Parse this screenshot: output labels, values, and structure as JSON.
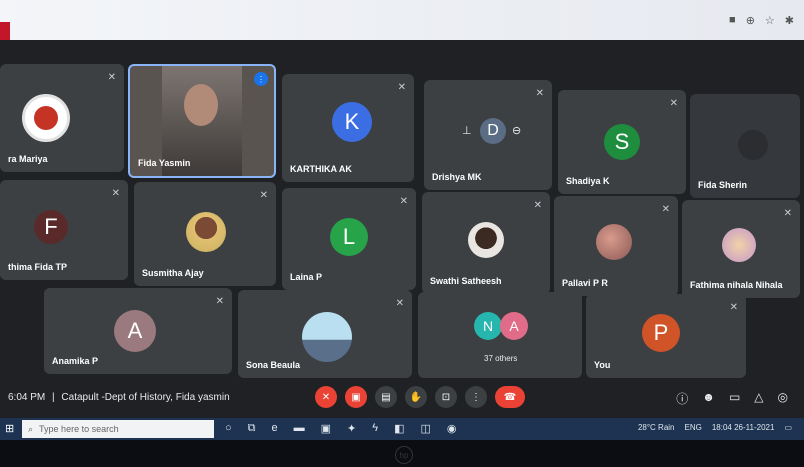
{
  "meeting": {
    "time": "6:04 PM",
    "separator": "|",
    "title": "Catapult -Dept of History, Fida yasmin"
  },
  "participants": {
    "ra_mariya": "ra Mariya",
    "fida_yasmin": "Fida Yasmin",
    "karthika": "KARTHIKA AK",
    "karthika_initial": "K",
    "drishya": "Drishya MK",
    "drishya_initial": "D",
    "shadiya": "Shadiya K",
    "shadiya_initial": "S",
    "fida_sherin": "Fida Sherin",
    "fathima_fida": "thima Fida TP",
    "fathima_fida_initial": "F",
    "susmitha": "Susmitha Ajay",
    "laina": "Laina P",
    "laina_initial": "L",
    "swathi": "Swathi Satheesh",
    "pallavi": "Pallavi P R",
    "fathima_nihala": "Fathima nihala Nihala",
    "anamika": "Anamika P",
    "anamika_initial": "A",
    "sona": "Sona Beaula",
    "others_count": "37 others",
    "others_initial_1": "N",
    "others_initial_2": "A",
    "you": "You",
    "you_initial": "P"
  },
  "taskbar": {
    "search_placeholder": "Type here to search",
    "weather": "28°C Rain",
    "lang": "ENG",
    "clock_time": "18:04",
    "clock_date": "26-11-2021"
  },
  "colors": {
    "karthika": "#3b6ee3",
    "shadiya": "#1e8e3e",
    "fathima_fida": "#5a2a2a",
    "laina": "#27a34a",
    "anamika": "#9a7a7e",
    "others_n": "#26b6ad",
    "others_a": "#e06c8a",
    "you": "#d15429"
  }
}
